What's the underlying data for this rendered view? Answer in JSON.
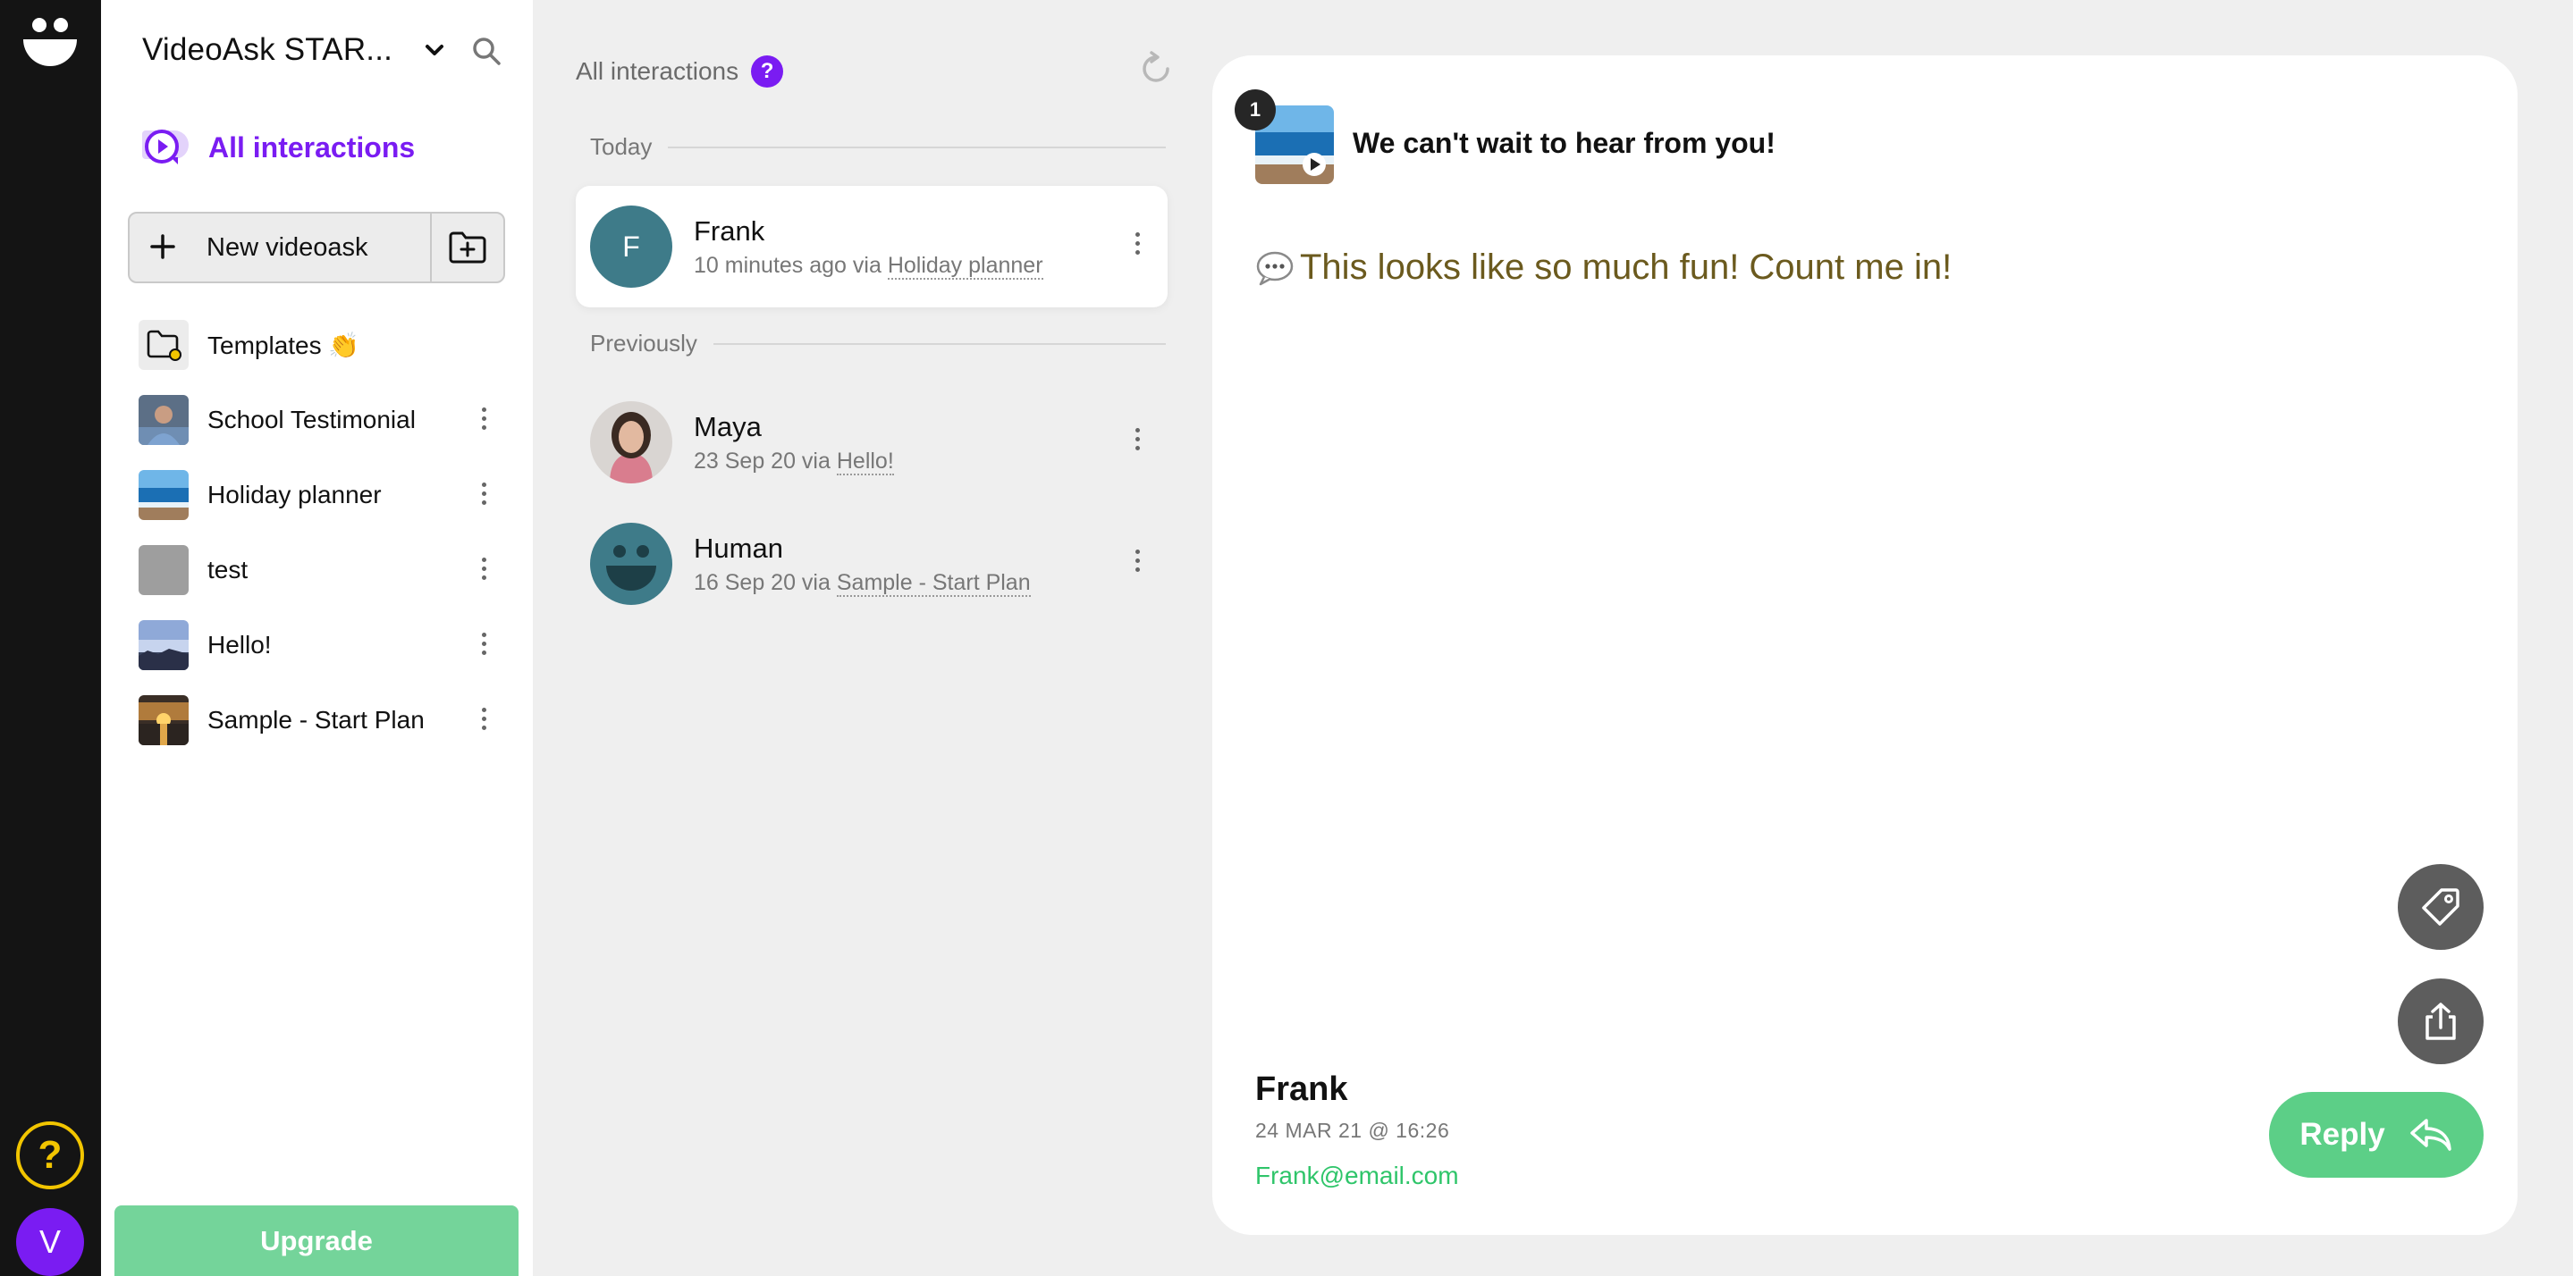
{
  "workspace": {
    "title": "VideoAsk STAR..."
  },
  "nav": {
    "all_interactions": "All interactions"
  },
  "sidebar": {
    "new_videoask": "New videoask",
    "folders": [
      {
        "label": "Templates 👏",
        "thumb": "templates-icon"
      },
      {
        "label": "School Testimonial",
        "thumb": "school-photo"
      },
      {
        "label": "Holiday planner",
        "thumb": "beach-photo"
      },
      {
        "label": "test",
        "thumb": "gray-placeholder"
      },
      {
        "label": "Hello!",
        "thumb": "sky-photo"
      },
      {
        "label": "Sample - Start Plan",
        "thumb": "sunset-photo"
      }
    ],
    "upgrade": "Upgrade"
  },
  "rail": {
    "help": "?",
    "avatar_initial": "V"
  },
  "list": {
    "header": "All interactions",
    "help_badge": "?",
    "sections": [
      {
        "title": "Today",
        "items": [
          {
            "name": "Frank",
            "time": "10 minutes ago via",
            "via": "Holiday planner",
            "initial": "F"
          }
        ]
      },
      {
        "title": "Previously",
        "items": [
          {
            "name": "Maya",
            "time": "23 Sep 20 via",
            "via": "Hello!"
          },
          {
            "name": "Human",
            "time": "16 Sep 20 via",
            "via": "Sample - Start Plan"
          }
        ]
      }
    ]
  },
  "detail": {
    "question_number": "1",
    "question_title": "We can't wait to hear from you!",
    "message": "This looks like so much fun! Count me in!",
    "respondent": {
      "name": "Frank",
      "date": "24 MAR 21 @ 16:26",
      "email": "Frank@email.com"
    },
    "reply": "Reply"
  },
  "colors": {
    "accent": "#7a1cf2",
    "green": "#5ccf87",
    "teal_avatar": "#3e7b89",
    "rail": "#141414"
  }
}
